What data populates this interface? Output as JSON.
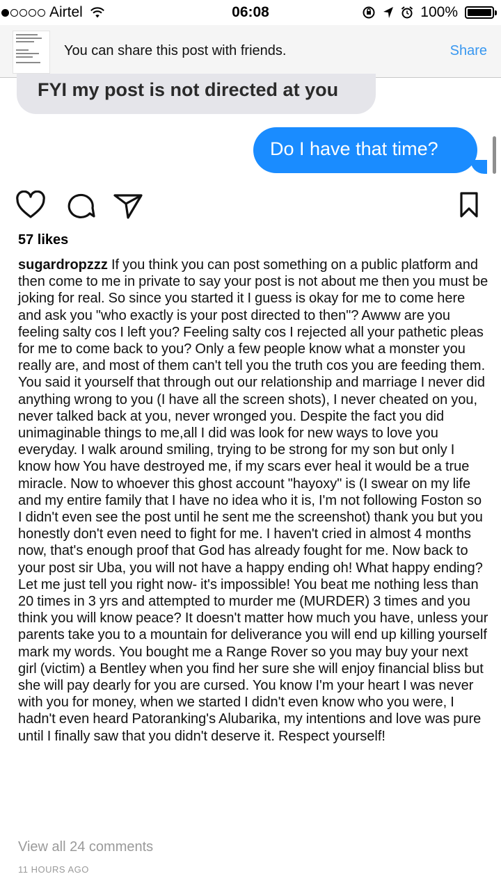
{
  "status_bar": {
    "carrier": "Airtel",
    "time": "06:08",
    "battery": "100%",
    "signal_bars_filled": 1,
    "signal_bars_total": 5
  },
  "share_banner": {
    "message": "You can share this post with friends.",
    "share_label": "Share"
  },
  "screenshot": {
    "received_message": "FYI my post is not directed at you",
    "sent_message": "Do I have that time?"
  },
  "post": {
    "likes": "57 likes",
    "username": "sugardropzzz",
    "caption": "If you think you can post something on a public platform and then come to me in private to say your post is not about me then you must be joking for real. So since you started it I guess is okay for me to come here and ask you \"who exactly is your post directed to then\"? Awww are you feeling salty cos I left you? Feeling salty cos I rejected all your pathetic pleas for me to come back to you? Only a few people know what a monster you really are, and most of them can't tell you the truth cos you are feeding them. You said it yourself that through out our relationship and marriage I never did anything wrong to you (I have all the screen shots), I never cheated on you, never talked back at you, never wronged you. Despite the fact you did unimaginable things to me,all I did was look for new ways to love you everyday. I walk around smiling, trying to be strong for my son but only I know how You have destroyed me, if my scars ever heal it would be a true miracle. Now to whoever this ghost account \"hayoxy\" is (I swear on my life and my entire family that I have no idea who it is, I'm not following Foston so I didn't even see the post until he sent me the screenshot) thank you but you honestly don't even need to fight for me. I haven't cried in almost 4 months now, that's enough proof that God has already fought for me. Now back to your post sir Uba, you will not have a happy ending oh! What happy ending? Let me just tell you right now- it's impossible! You beat me nothing less than 20 times in 3 yrs and attempted to murder me (MURDER) 3 times and you think you will know peace? It doesn't matter how much you have, unless your parents take you to a mountain for deliverance you will end up killing yourself mark my words. You bought me a Range Rover so you may buy your next girl (victim)  a Bentley when you find her sure she will enjoy financial bliss but she will pay dearly for you are cursed. You know I'm your heart I was never with you for money, when we started I didn't even know who you were, I hadn't even heard Patoranking's Alubarika, my intentions and love was pure until I finally saw that you didn't deserve it. Respect yourself!",
    "comments_link": "View all 24 comments",
    "timestamp": "11 HOURS AGO"
  },
  "icons": [
    "heart-icon",
    "comment-icon",
    "share-direct-icon",
    "bookmark-icon",
    "wifi-icon",
    "orientation-lock-icon",
    "location-arrow-icon",
    "alarm-icon",
    "battery-icon"
  ],
  "colors": {
    "accent": "#3897f0",
    "sent_bubble": "#1a8cff",
    "received_bubble": "#e5e5ea",
    "muted_text": "#9a9a9a"
  }
}
